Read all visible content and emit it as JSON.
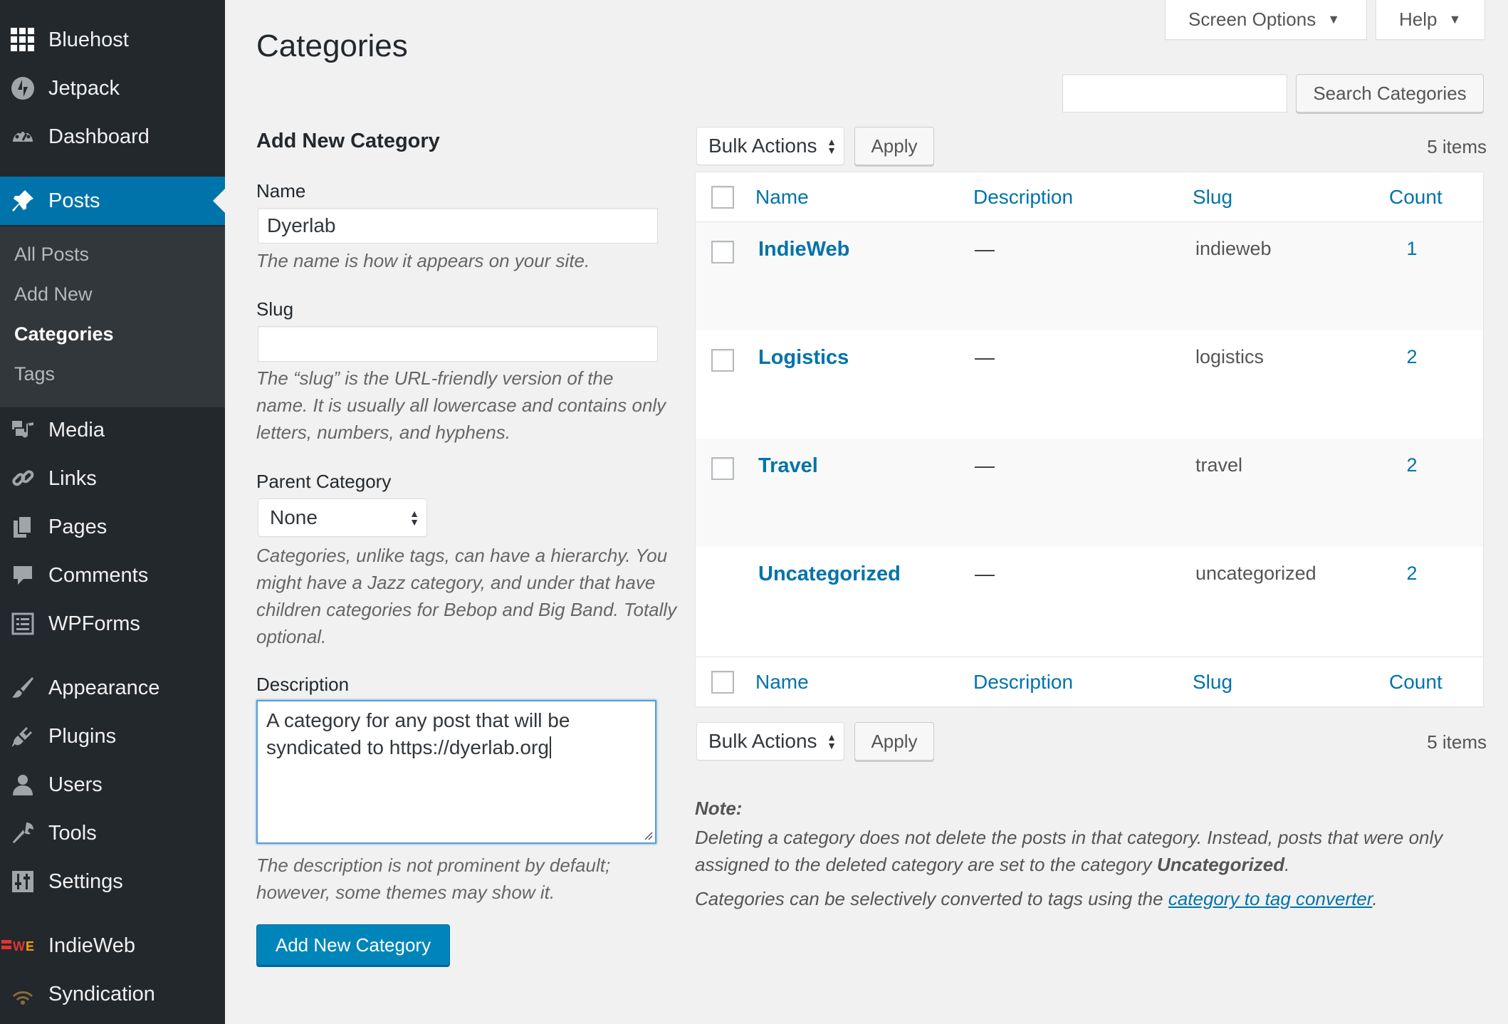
{
  "sidebar": {
    "items": [
      {
        "label": "Bluehost",
        "icon": "grid-icon"
      },
      {
        "label": "Jetpack",
        "icon": "jetpack-icon"
      },
      {
        "label": "Dashboard",
        "icon": "dashboard-icon"
      },
      {
        "label": "Posts",
        "icon": "pin-icon",
        "current": true
      },
      {
        "label": "Media",
        "icon": "media-icon"
      },
      {
        "label": "Links",
        "icon": "link-icon"
      },
      {
        "label": "Pages",
        "icon": "pages-icon"
      },
      {
        "label": "Comments",
        "icon": "comment-icon"
      },
      {
        "label": "WPForms",
        "icon": "wpforms-icon"
      },
      {
        "label": "Appearance",
        "icon": "brush-icon"
      },
      {
        "label": "Plugins",
        "icon": "plugin-icon"
      },
      {
        "label": "Users",
        "icon": "user-icon"
      },
      {
        "label": "Tools",
        "icon": "wrench-icon"
      },
      {
        "label": "Settings",
        "icon": "settings-icon"
      },
      {
        "label": "IndieWeb",
        "icon": "indieweb-icon"
      },
      {
        "label": "Syndication",
        "icon": "wifi-icon"
      }
    ],
    "submenu": [
      "All Posts",
      "Add New",
      "Categories",
      "Tags"
    ],
    "submenu_active": "Categories"
  },
  "header": {
    "screen_options": "Screen Options",
    "help": "Help",
    "page_title": "Categories"
  },
  "form": {
    "heading": "Add New Category",
    "name_label": "Name",
    "name_value": "Dyerlab",
    "name_help": "The name is how it appears on your site.",
    "slug_label": "Slug",
    "slug_value": "",
    "slug_help": "The “slug” is the URL-friendly version of the name. It is usually all lowercase and contains only letters, numbers, and hyphens.",
    "parent_label": "Parent Category",
    "parent_value": "None",
    "parent_help": "Categories, unlike tags, can have a hierarchy. You might have a Jazz category, and under that have children categories for Bebop and Big Band. Totally optional.",
    "description_label": "Description",
    "description_value": "A category for any post that will be syndicated to https://dyerlab.org",
    "description_help": "The description is not prominent by default; however, some themes may show it.",
    "submit": "Add New Category"
  },
  "list": {
    "search_button": "Search Categories",
    "search_value": "",
    "bulk_actions": "Bulk Actions",
    "apply": "Apply",
    "items_count": "5 items",
    "columns": {
      "name": "Name",
      "description": "Description",
      "slug": "Slug",
      "count": "Count"
    },
    "rows": [
      {
        "name": "IndieWeb",
        "description": "—",
        "slug": "indieweb",
        "count": "1"
      },
      {
        "name": "Logistics",
        "description": "—",
        "slug": "logistics",
        "count": "2"
      },
      {
        "name": "Travel",
        "description": "—",
        "slug": "travel",
        "count": "2"
      },
      {
        "name": "Uncategorized",
        "description": "—",
        "slug": "uncategorized",
        "count": "2"
      }
    ]
  },
  "note": {
    "title": "Note:",
    "line1_prefix": "Deleting a category does not delete the posts in that category. Instead, posts that were only assigned to the deleted category are set to the category ",
    "line1_bold": "Uncategorized",
    "line1_suffix": ".",
    "line2_prefix": "Categories can be selectively converted to tags using the ",
    "line2_link": "category to tag converter",
    "line2_suffix": "."
  },
  "colors": {
    "accent": "#0073aa",
    "sidebar": "#23282d",
    "submenu": "#32373c",
    "primary_button": "#0085ba"
  }
}
